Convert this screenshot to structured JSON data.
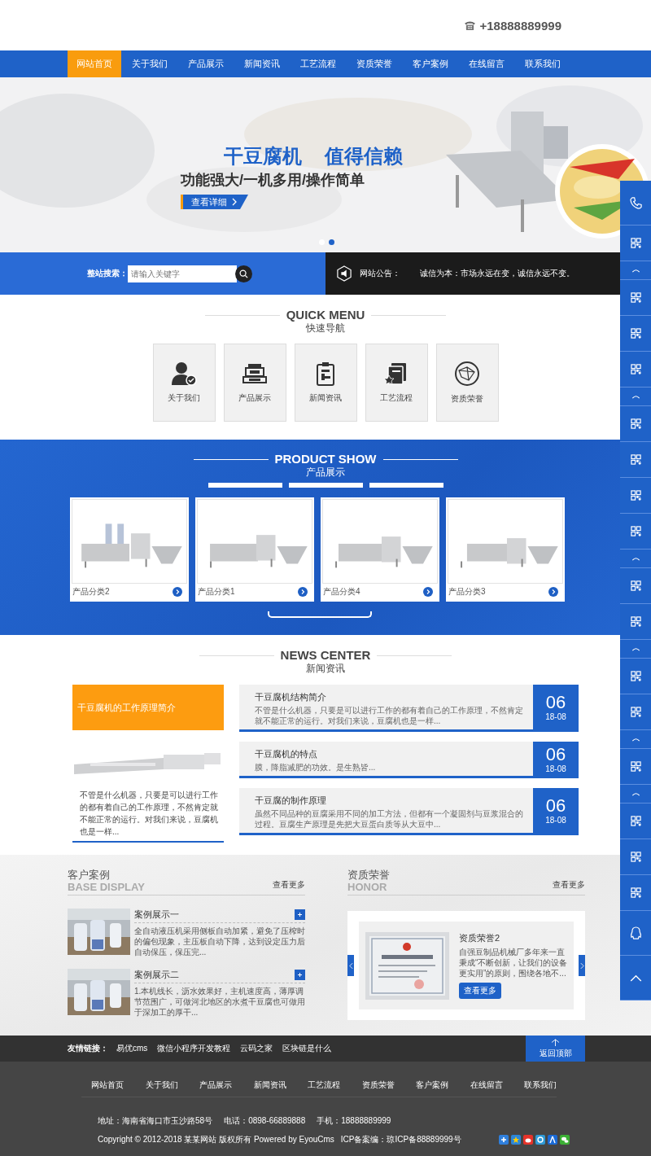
{
  "header": {
    "phone": "+18888889999"
  },
  "nav": [
    {
      "label": "网站首页",
      "selected": true
    },
    {
      "label": "关于我们",
      "selected": false
    },
    {
      "label": "产品展示",
      "selected": false
    },
    {
      "label": "新闻资讯",
      "selected": false
    },
    {
      "label": "工艺流程",
      "selected": false
    },
    {
      "label": "资质荣誉",
      "selected": false
    },
    {
      "label": "客户案例",
      "selected": false
    },
    {
      "label": "在线留言",
      "selected": false
    },
    {
      "label": "联系我们",
      "selected": false
    }
  ],
  "banner": {
    "title_1": "干豆腐机",
    "title_2": "值得信赖",
    "subtitle": "功能强大/一机多用/操作简单",
    "button": "查看详细",
    "slides": [
      {
        "selected": false
      },
      {
        "selected": true
      }
    ]
  },
  "search": {
    "label": "整站搜索：",
    "placeholder": "请输入关键字"
  },
  "notice": {
    "label": "网站公告：",
    "text": "诚信为本：市场永远在变，诚信永远不变。"
  },
  "quick_menu": {
    "title": "QUICK MENU",
    "subtitle": "快速导航",
    "items": [
      {
        "label": "关于我们",
        "kind": "person"
      },
      {
        "label": "产品展示",
        "kind": "machine"
      },
      {
        "label": "新闻资讯",
        "kind": "clipboard"
      },
      {
        "label": "工艺流程",
        "kind": "book"
      },
      {
        "label": "资质荣誉",
        "kind": "globe"
      }
    ]
  },
  "products": {
    "title": "PRODUCT SHOW",
    "subtitle": "产品展示",
    "items": [
      {
        "name": "产品分类2"
      },
      {
        "name": "产品分类1"
      },
      {
        "name": "产品分类4"
      },
      {
        "name": "产品分类3"
      }
    ]
  },
  "news": {
    "title": "NEWS CENTER",
    "subtitle": "新闻资讯",
    "featured": {
      "title": "干豆腐机的工作原理简介",
      "summary": "不管是什么机器，只要是可以进行工作的都有着自己的工作原理，不然肯定就不能正常的运行。对我们来说，豆腐机也是一样..."
    },
    "items": [
      {
        "title": "干豆腐机结构简介",
        "summary": "不管是什么机器，只要是可以进行工作的都有着自己的工作原理，不然肯定就不能正常的运行。对我们来说，豆腐机也是一样...",
        "day": "06",
        "date": "18-08"
      },
      {
        "title": "干豆腐机的特点",
        "summary": "膜，降脂减肥的功效。是生熟皆...",
        "day": "06",
        "date": "18-08"
      },
      {
        "title": "干豆腐的制作原理",
        "summary": "虽然不同品种的豆腐采用不同的加工方法，但都有一个凝固剂与豆浆混合的过程。豆腐生产原理是先把大豆蛋白质等从大豆中...",
        "day": "06",
        "date": "18-08"
      }
    ]
  },
  "cases": {
    "title": "客户案例",
    "subtitle": "BASE DISPLAY",
    "more": "查看更多",
    "items": [
      {
        "title": "案例展示一",
        "summary": "全自动液压机采用侧板自动加紧，避免了压榨时的偏包现象，主压板自动下降，达到设定压力后自动保压，保压完..."
      },
      {
        "title": "案例展示二",
        "summary": "1.本机线长，沥水效果好，主机速度高，薄厚调节范围广，可做河北地区的水煮干豆腐也可做用于深加工的厚干..."
      }
    ]
  },
  "honor": {
    "title": "资质荣誉",
    "subtitle": "HONOR",
    "more": "查看更多",
    "item": {
      "title": "资质荣誉2",
      "summary": "自强豆制品机械厂多年来一直秉成“不断创新，让我们的设备更实用”的原则，围绕各地不...",
      "button": "查看更多"
    }
  },
  "links": {
    "label": "友情链接：",
    "items": [
      "易优cms",
      "微信小程序开发教程",
      "云码之家",
      "区块链是什么"
    ],
    "back_to_top": "返回顶部"
  },
  "footer": {
    "nav": [
      "网站首页",
      "关于我们",
      "产品展示",
      "新闻资讯",
      "工艺流程",
      "资质荣誉",
      "客户案例",
      "在线留言",
      "联系我们"
    ],
    "address": "地址：海南省海口市玉沙路58号",
    "phone": "电话：0898-66889888",
    "mobile": "手机：18888889999",
    "copyright": "Copyright © 2012-2018 某某网站 版权所有 Powered by EyouCms",
    "icp": "ICP备案编：琼ICP备88889999号",
    "share": [
      {
        "kind": "plus",
        "color": "#2f7fdc"
      },
      {
        "kind": "star",
        "color": "#2b86d9"
      },
      {
        "kind": "weibo",
        "color": "#e6332a"
      },
      {
        "kind": "ring",
        "color": "#2f9ad6"
      },
      {
        "kind": "person",
        "color": "#1a6ad6"
      },
      {
        "kind": "chat",
        "color": "#3bb034"
      }
    ]
  },
  "side_tools": [
    {
      "kind": "phone"
    },
    {
      "kind": "qr"
    },
    {
      "kind": "caret"
    },
    {
      "kind": "qr"
    },
    {
      "kind": "qr"
    },
    {
      "kind": "qr"
    },
    {
      "kind": "caret"
    },
    {
      "kind": "qr"
    },
    {
      "kind": "qr"
    },
    {
      "kind": "qr"
    },
    {
      "kind": "qr"
    },
    {
      "kind": "caret"
    },
    {
      "kind": "qr"
    },
    {
      "kind": "qr"
    },
    {
      "kind": "caret"
    },
    {
      "kind": "qr"
    },
    {
      "kind": "qr"
    },
    {
      "kind": "caret"
    },
    {
      "kind": "qr"
    },
    {
      "kind": "caret"
    },
    {
      "kind": "qr"
    },
    {
      "kind": "qr"
    },
    {
      "kind": "qr"
    },
    {
      "kind": "qq"
    },
    {
      "kind": "top"
    }
  ]
}
